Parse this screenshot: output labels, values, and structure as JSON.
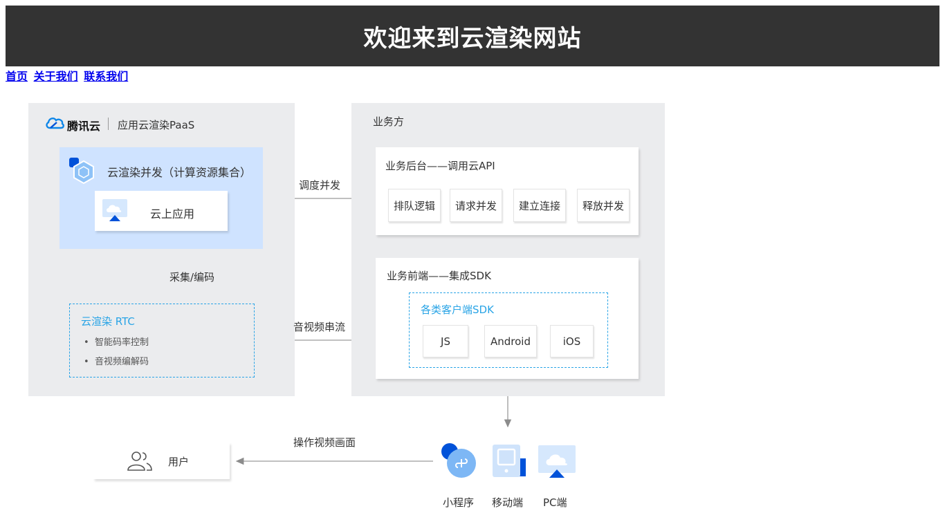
{
  "header": {
    "title": "欢迎来到云渲染网站"
  },
  "nav": {
    "items": [
      "首页",
      "关于我们",
      "联系我们"
    ]
  },
  "diagram": {
    "left_panel": {
      "brand": "腾讯云",
      "product": "应用云渲染PaaS",
      "concurrency_box": {
        "title": "云渲染并发（计算资源集合）",
        "app_label": "云上应用"
      },
      "capture_label": "采集/编码",
      "rtc_box": {
        "title": "云渲染 RTC",
        "bullets": [
          "智能码率控制",
          "音视频编解码"
        ]
      }
    },
    "right_panel": {
      "title": "业务方",
      "backend": {
        "title": "业务后台——调用云API",
        "actions": [
          "排队逻辑",
          "请求并发",
          "建立连接",
          "释放并发"
        ]
      },
      "frontend": {
        "title": "业务前端——集成SDK",
        "sdk_box": {
          "title": "各类客户端SDK",
          "sdks": [
            "JS",
            "Android",
            "iOS"
          ]
        }
      }
    },
    "edges": {
      "dispatch": "调度并发",
      "stream": "音视频串流",
      "operate": "操作视频画面"
    },
    "user_label": "用户",
    "clients": [
      "小程序",
      "移动端",
      "PC端"
    ],
    "colors": {
      "panel_bg": "#ebecee",
      "concurrency_bg": "#cfe3ff",
      "accent_blue": "#29a4e6",
      "brand_blue": "#0052d9",
      "header_bg": "#333333"
    }
  }
}
